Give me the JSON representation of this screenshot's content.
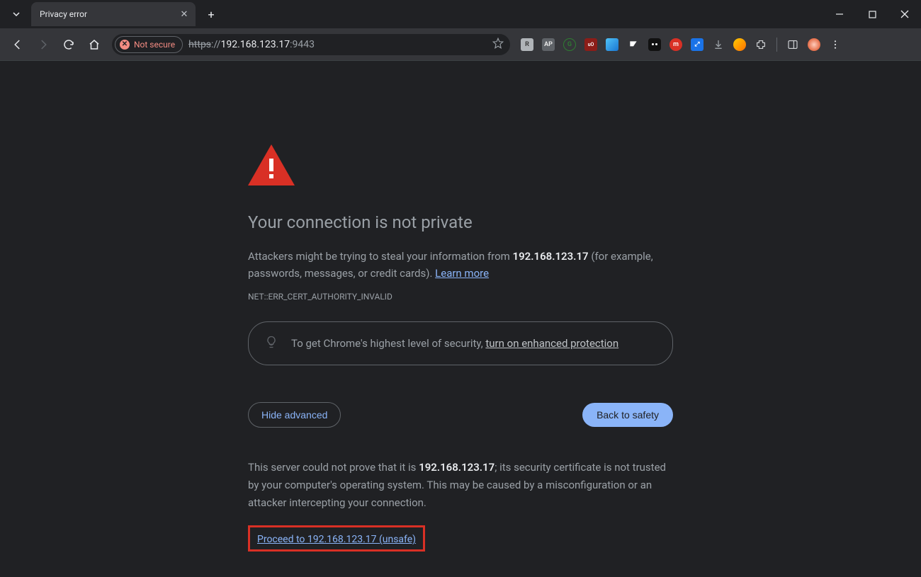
{
  "tab": {
    "title": "Privacy error"
  },
  "omnibox": {
    "security_chip": "Not secure",
    "scheme": "https",
    "sep1": "://",
    "host": "192.168.123.17",
    "port": ":9443"
  },
  "warning": {
    "heading": "Your connection is not private",
    "desc_prefix": "Attackers might be trying to steal your information from ",
    "desc_host": "192.168.123.17",
    "desc_suffix": " (for example, passwords, messages, or credit cards). ",
    "learn_more": "Learn more",
    "error_code": "NET::ERR_CERT_AUTHORITY_INVALID",
    "promo_prefix": "To get Chrome's highest level of security, ",
    "promo_link": "turn on enhanced protection",
    "hide_advanced": "Hide advanced",
    "back_to_safety": "Back to safety",
    "expl_prefix": "This server could not prove that it is ",
    "expl_host": "192.168.123.17",
    "expl_suffix": "; its security certificate is not trusted by your computer's operating system. This may be caused by a misconfiguration or an attacker intercepting your connection.",
    "proceed": "Proceed to 192.168.123.17 (unsafe)"
  }
}
